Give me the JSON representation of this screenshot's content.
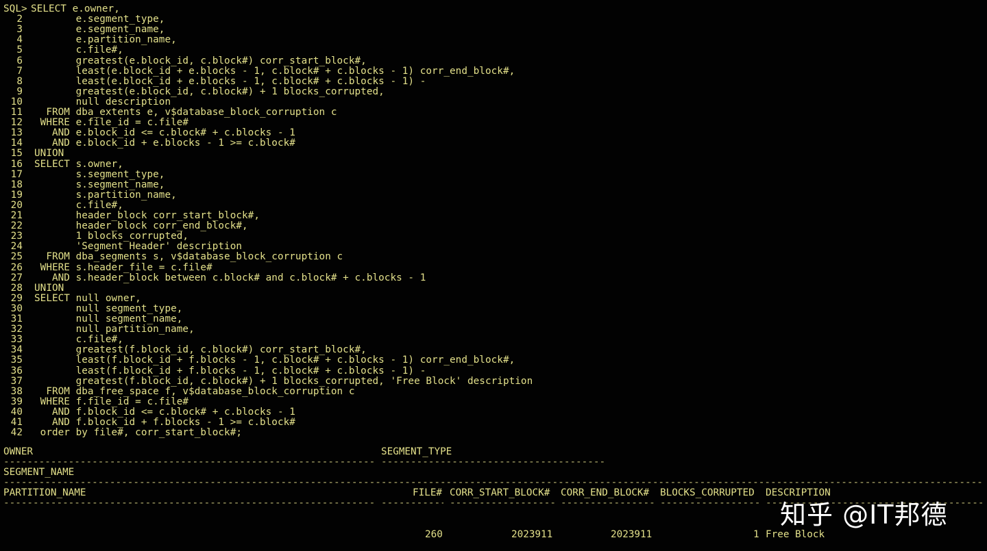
{
  "prompt": "SQL>",
  "query_lines": [
    {
      "no": "",
      "code": "SELECT e.owner,"
    },
    {
      "no": "2",
      "code": "       e.segment_type,"
    },
    {
      "no": "3",
      "code": "       e.segment_name,"
    },
    {
      "no": "4",
      "code": "       e.partition_name,"
    },
    {
      "no": "5",
      "code": "       c.file#,"
    },
    {
      "no": "6",
      "code": "       greatest(e.block_id, c.block#) corr_start_block#,"
    },
    {
      "no": "7",
      "code": "       least(e.block_id + e.blocks - 1, c.block# + c.blocks - 1) corr_end_block#,"
    },
    {
      "no": "8",
      "code": "       least(e.block_id + e.blocks - 1, c.block# + c.blocks - 1) -"
    },
    {
      "no": "9",
      "code": "       greatest(e.block_id, c.block#) + 1 blocks_corrupted,"
    },
    {
      "no": "10",
      "code": "       null description"
    },
    {
      "no": "11",
      "code": "  FROM dba_extents e, v$database_block_corruption c"
    },
    {
      "no": "12",
      "code": " WHERE e.file_id = c.file#"
    },
    {
      "no": "13",
      "code": "   AND e.block_id <= c.block# + c.blocks - 1"
    },
    {
      "no": "14",
      "code": "   AND e.block_id + e.blocks - 1 >= c.block#"
    },
    {
      "no": "15",
      "code": "UNION"
    },
    {
      "no": "16",
      "code": "SELECT s.owner,"
    },
    {
      "no": "17",
      "code": "       s.segment_type,"
    },
    {
      "no": "18",
      "code": "       s.segment_name,"
    },
    {
      "no": "19",
      "code": "       s.partition_name,"
    },
    {
      "no": "20",
      "code": "       c.file#,"
    },
    {
      "no": "21",
      "code": "       header_block corr_start_block#,"
    },
    {
      "no": "22",
      "code": "       header_block corr_end_block#,"
    },
    {
      "no": "23",
      "code": "       1 blocks_corrupted,"
    },
    {
      "no": "24",
      "code": "       'Segment Header' description"
    },
    {
      "no": "25",
      "code": "  FROM dba_segments s, v$database_block_corruption c"
    },
    {
      "no": "26",
      "code": " WHERE s.header_file = c.file#"
    },
    {
      "no": "27",
      "code": "   AND s.header_block between c.block# and c.block# + c.blocks - 1"
    },
    {
      "no": "28",
      "code": "UNION"
    },
    {
      "no": "29",
      "code": "SELECT null owner,"
    },
    {
      "no": "30",
      "code": "       null segment_type,"
    },
    {
      "no": "31",
      "code": "       null segment_name,"
    },
    {
      "no": "32",
      "code": "       null partition_name,"
    },
    {
      "no": "33",
      "code": "       c.file#,"
    },
    {
      "no": "34",
      "code": "       greatest(f.block_id, c.block#) corr_start_block#,"
    },
    {
      "no": "35",
      "code": "       least(f.block_id + f.blocks - 1, c.block# + c.blocks - 1) corr_end_block#,"
    },
    {
      "no": "36",
      "code": "       least(f.block_id + f.blocks - 1, c.block# + c.blocks - 1) -"
    },
    {
      "no": "37",
      "code": "       greatest(f.block_id, c.block#) + 1 blocks_corrupted, 'Free Block' description"
    },
    {
      "no": "38",
      "code": "  FROM dba_free_space f, v$database_block_corruption c"
    },
    {
      "no": "39",
      "code": " WHERE f.file_id = c.file#"
    },
    {
      "no": "40",
      "code": "   AND f.block_id <= c.block# + c.blocks - 1"
    },
    {
      "no": "41",
      "code": "   AND f.block_id + f.blocks - 1 >= c.block#"
    },
    {
      "no": "42",
      "code": " order by file#, corr_start_block#;"
    }
  ],
  "result": {
    "headers": {
      "owner": "OWNER",
      "segment_type": "SEGMENT_TYPE",
      "segment_name": "SEGMENT_NAME",
      "partition_name": "PARTITION_NAME",
      "file": "FILE#",
      "corr_start_block": "CORR_START_BLOCK#",
      "corr_end_block": "CORR_END_BLOCK#",
      "blocks_corrupted": "BLOCKS_CORRUPTED",
      "description": "DESCRIPTION"
    },
    "row": {
      "file": "260",
      "corr_start_block": "2023911",
      "corr_end_block": "2023911",
      "blocks_corrupted": "1",
      "description": "Free Block"
    }
  },
  "watermark": "知乎 @IT邦德"
}
